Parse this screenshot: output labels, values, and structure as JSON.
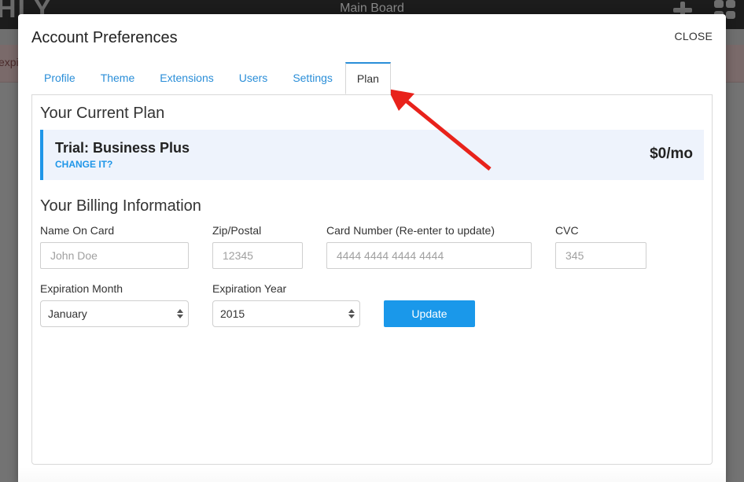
{
  "background": {
    "logo_fragment": "HLY",
    "board_title": "Main Board",
    "alert_fragment": "expi"
  },
  "modal": {
    "title": "Account Preferences",
    "close_label": "CLOSE",
    "tabs": [
      {
        "label": "Profile",
        "active": false
      },
      {
        "label": "Theme",
        "active": false
      },
      {
        "label": "Extensions",
        "active": false
      },
      {
        "label": "Users",
        "active": false
      },
      {
        "label": "Settings",
        "active": false
      },
      {
        "label": "Plan",
        "active": true
      }
    ]
  },
  "current_plan": {
    "heading": "Your Current Plan",
    "plan_name": "Trial: Business Plus",
    "change_link": "CHANGE IT?",
    "price": "$0/mo"
  },
  "billing": {
    "heading": "Your Billing Information",
    "name_on_card": {
      "label": "Name On Card",
      "value": "",
      "placeholder": "John Doe"
    },
    "zip": {
      "label": "Zip/Postal",
      "value": "",
      "placeholder": "12345"
    },
    "card_number": {
      "label": "Card Number (Re-enter to update)",
      "value": "",
      "placeholder": "4444 4444 4444 4444"
    },
    "cvc": {
      "label": "CVC",
      "value": "",
      "placeholder": "345"
    },
    "expiration_month": {
      "label": "Expiration Month",
      "selected": "January"
    },
    "expiration_year": {
      "label": "Expiration Year",
      "selected": "2015"
    },
    "update_label": "Update"
  },
  "colors": {
    "accent": "#1f96e8",
    "annotation_arrow": "#e8221b",
    "plan_box_bg": "#eef3fc"
  }
}
